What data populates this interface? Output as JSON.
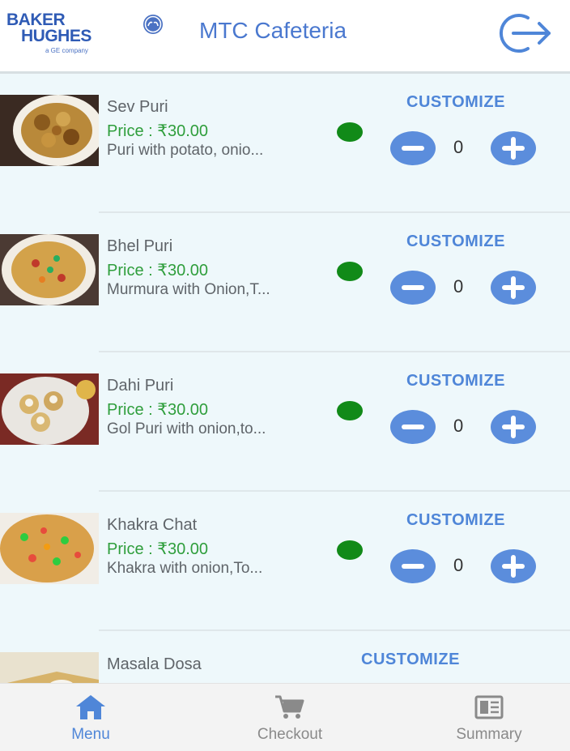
{
  "header": {
    "logo_line1": "BAKER",
    "logo_line2": "HUGHES",
    "logo_sub": "a GE company",
    "title": "MTC Cafeteria",
    "logout_icon": "logout-icon"
  },
  "items": [
    {
      "name": "Sev Puri",
      "price": "Price : ₹30.00",
      "desc": "Puri with potato, onio...",
      "qty": "0",
      "customize": "CUSTOMIZE",
      "veg": true
    },
    {
      "name": "Bhel Puri",
      "price": "Price : ₹30.00",
      "desc": "Murmura with Onion,T...",
      "qty": "0",
      "customize": "CUSTOMIZE",
      "veg": true
    },
    {
      "name": "Dahi Puri",
      "price": "Price : ₹30.00",
      "desc": "Gol Puri with onion,to...",
      "qty": "0",
      "customize": "CUSTOMIZE",
      "veg": true
    },
    {
      "name": "Khakra Chat",
      "price": "Price : ₹30.00",
      "desc": "Khakra with onion,To...",
      "qty": "0",
      "customize": "CUSTOMIZE",
      "veg": true
    },
    {
      "name": "Masala Dosa",
      "customize": "CUSTOMIZE"
    }
  ],
  "nav": {
    "tabs": [
      {
        "label": "Menu",
        "icon": "home-icon",
        "active": true
      },
      {
        "label": "Checkout",
        "icon": "cart-icon",
        "active": false
      },
      {
        "label": "Summary",
        "icon": "receipt-icon",
        "active": false
      }
    ]
  },
  "colors": {
    "accent": "#4f86d8",
    "price_green": "#2f9e3c",
    "veg_dot": "#118a18",
    "background": "#eef8fb",
    "nav_inactive": "#8a8a8a"
  }
}
